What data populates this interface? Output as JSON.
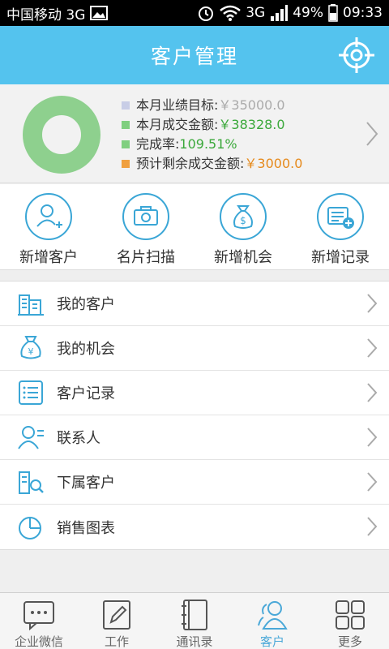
{
  "status_bar": {
    "carrier": "中国移动 3G",
    "network": "3G",
    "battery": "49%",
    "time": "09:33"
  },
  "header": {
    "title": "客户管理"
  },
  "summary": {
    "completion_fraction": 1.0,
    "colors": {
      "target": "#c8cde6",
      "deal": "#7fcf7f",
      "rate": "#7fcf7f",
      "remaining": "#f0a040",
      "donut": "#8ed08e"
    },
    "rows": [
      {
        "label": "本月业绩目标:",
        "value": "￥35000.0"
      },
      {
        "label": "本月成交金额:",
        "value": "￥38328.0"
      },
      {
        "label": "完成率:",
        "value": "109.51%"
      },
      {
        "label": "预计剩余成交金额:",
        "value": "￥3000.0"
      }
    ]
  },
  "actions": [
    {
      "label": "新增客户",
      "icon": "add-user-icon"
    },
    {
      "label": "名片扫描",
      "icon": "camera-icon"
    },
    {
      "label": "新增机会",
      "icon": "money-bag-icon"
    },
    {
      "label": "新增记录",
      "icon": "add-record-icon"
    }
  ],
  "menu": [
    {
      "label": "我的客户",
      "icon": "buildings-icon"
    },
    {
      "label": "我的机会",
      "icon": "money-bag-icon"
    },
    {
      "label": "客户记录",
      "icon": "list-icon"
    },
    {
      "label": "联系人",
      "icon": "contact-icon"
    },
    {
      "label": "下属客户",
      "icon": "subordinate-icon"
    },
    {
      "label": "销售图表",
      "icon": "pie-chart-icon"
    }
  ],
  "tabs": [
    {
      "label": "企业微信",
      "icon": "chat-icon",
      "active": false
    },
    {
      "label": "工作",
      "icon": "edit-icon",
      "active": false
    },
    {
      "label": "通讯录",
      "icon": "address-book-icon",
      "active": false
    },
    {
      "label": "客户",
      "icon": "customers-icon",
      "active": true
    },
    {
      "label": "更多",
      "icon": "grid-icon",
      "active": false
    }
  ],
  "colors": {
    "accent": "#54c3ee",
    "icon": "#3aa6d6"
  }
}
